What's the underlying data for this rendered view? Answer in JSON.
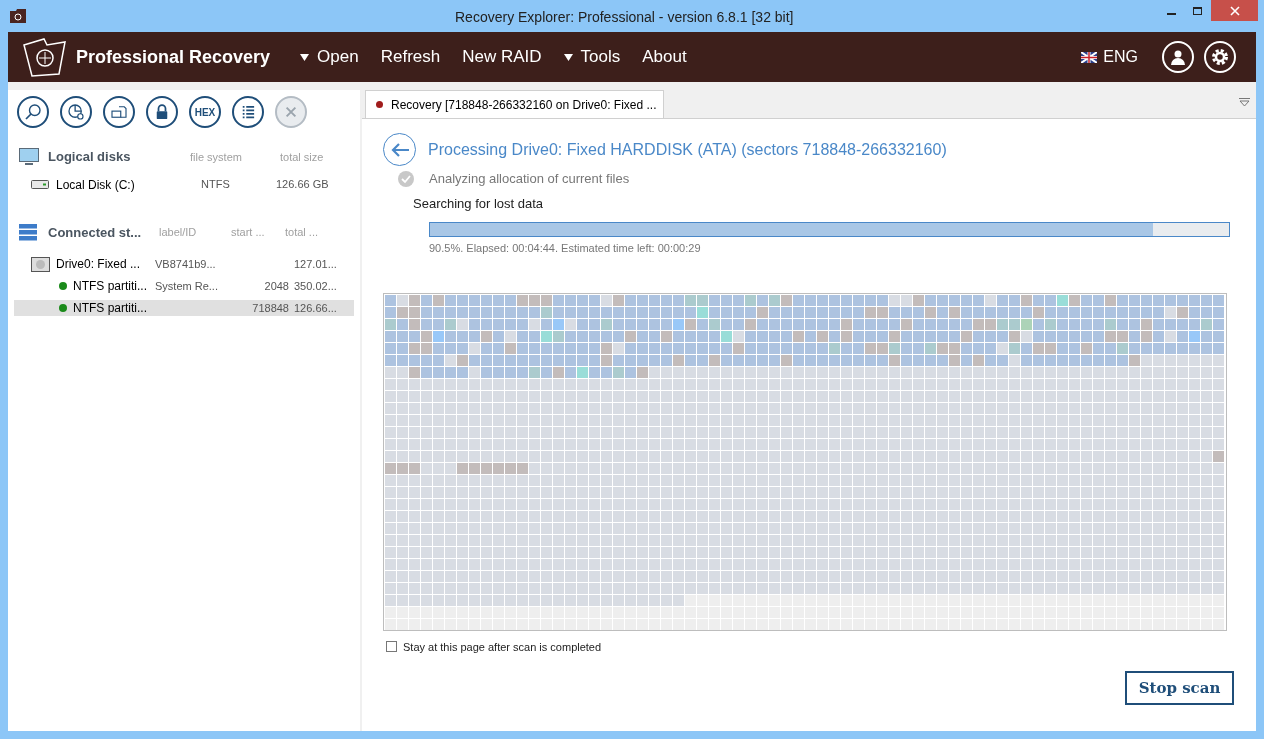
{
  "window": {
    "title": "Recovery Explorer: Professional - version 6.8.1 [32 bit]"
  },
  "app": {
    "name": "Professional Recovery"
  },
  "menu": [
    {
      "label": "Open",
      "dropdown": true
    },
    {
      "label": "Refresh",
      "dropdown": false
    },
    {
      "label": "New RAID",
      "dropdown": false
    },
    {
      "label": "Tools",
      "dropdown": true
    },
    {
      "label": "About",
      "dropdown": false
    }
  ],
  "language": "ENG",
  "toolbar": [
    {
      "kind": "search",
      "disabled": false
    },
    {
      "kind": "chart",
      "disabled": false
    },
    {
      "kind": "image",
      "disabled": false
    },
    {
      "kind": "lock",
      "disabled": false
    },
    {
      "kind": "hex",
      "label": "HEX",
      "disabled": false
    },
    {
      "kind": "list",
      "disabled": false
    },
    {
      "kind": "close",
      "disabled": true
    }
  ],
  "logical_disks": {
    "title": "Logical disks",
    "columns": [
      "file system",
      "total size"
    ],
    "rows": [
      {
        "name": "Local Disk (C:)",
        "file_system": "NTFS",
        "size": "126.66 GB"
      }
    ]
  },
  "connected_storages": {
    "title": "Connected st...",
    "columns": [
      "label/ID",
      "start ...",
      "total ..."
    ],
    "rows": [
      {
        "name": "Drive0: Fixed ...",
        "label": "VB8741b9...",
        "total": "127.01...",
        "selected": false,
        "children": [
          {
            "name": "NTFS partiti...",
            "label": "System Re...",
            "start": "2048",
            "total": "350.02...",
            "color": "#1a8a1a",
            "selected": false
          },
          {
            "name": "NTFS partiti...",
            "start": "718848",
            "total": "126.66...",
            "color": "#1a8a1a",
            "selected": true
          }
        ]
      }
    ]
  },
  "tab": {
    "label": "Recovery [718848-266332160 on Drive0: Fixed ...",
    "color": "#a01c1c",
    "selected": true
  },
  "heading": "Processing Drive0: Fixed HARDDISK (ATA) (sectors 718848-266332160)",
  "steps": [
    {
      "label": "Analyzing allocation of current files",
      "done": true
    },
    {
      "label": "Searching for lost data",
      "done": false
    }
  ],
  "progress": {
    "level": 0.905,
    "text": "90.5%. Elapsed: 00:04:44. Estimated time left: 00:00:29"
  },
  "stay_checkbox": {
    "label": "Stay at this page after scan is completed",
    "checked": false
  },
  "stop_button": "Stop scan"
}
